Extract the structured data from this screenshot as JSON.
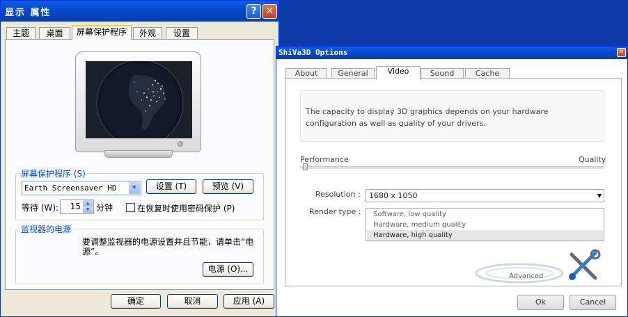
{
  "window1": {
    "title": "显示 属性",
    "help_button": "?",
    "close_button": "✕",
    "tabs": [
      {
        "label": "主题"
      },
      {
        "label": "桌面"
      },
      {
        "label": "屏幕保护程序",
        "active": true
      },
      {
        "label": "外观"
      },
      {
        "label": "设置"
      }
    ],
    "screensaver_group": {
      "label": "屏幕保护程序 (S)",
      "selected": "Earth Screensaver HD",
      "settings_button": "设置 (T)",
      "preview_button": "预览 (V)",
      "wait_label": "等待 (W):",
      "wait_value": "15",
      "minutes_label": "分钟",
      "password_checkbox_label": "在恢复时使用密码保护 (P)",
      "password_checked": false
    },
    "power_group": {
      "label": "监视器的电源",
      "description_line1": "要调整监视器的电源设置并且节能，请单击“电",
      "description_line2": "源”。",
      "power_button": "电源 (O)..."
    },
    "buttons": {
      "ok": "确定",
      "cancel": "取消",
      "apply": "应用 (A)"
    }
  },
  "window2": {
    "title": "ShiVa3D Options",
    "close_button": "✕",
    "tabs": [
      {
        "label": "About"
      },
      {
        "label": "General"
      },
      {
        "label": "Video",
        "active": true
      },
      {
        "label": "Sound"
      },
      {
        "label": "Cache"
      }
    ],
    "info_line1": "The capacity to display 3D graphics depends on your hardware",
    "info_line2": "configuration as well as quality of your drivers.",
    "slider": {
      "left_label": "Performance",
      "right_label": "Quality",
      "value": 0.02
    },
    "resolution": {
      "label": "Resolution :",
      "value": "1680 x 1050"
    },
    "render_type": {
      "label": "Render type :",
      "options": [
        "Software, low quality",
        "Hardware, medium quality",
        "Hardware, high quality"
      ],
      "selected_index": 2
    },
    "advanced_label": "Advanced",
    "buttons": {
      "ok": "Ok",
      "cancel": "Cancel"
    }
  },
  "colors": {
    "xp_blue_title": "#0847c9",
    "desktop": "#0a3ba8",
    "group_label": "#0046d5",
    "tab_highlight": "#ffc83c"
  },
  "icons": [
    "help-icon",
    "close-icon",
    "dropdown-arrow-icon",
    "spin-up-icon",
    "spin-down-icon",
    "tools-icon"
  ]
}
